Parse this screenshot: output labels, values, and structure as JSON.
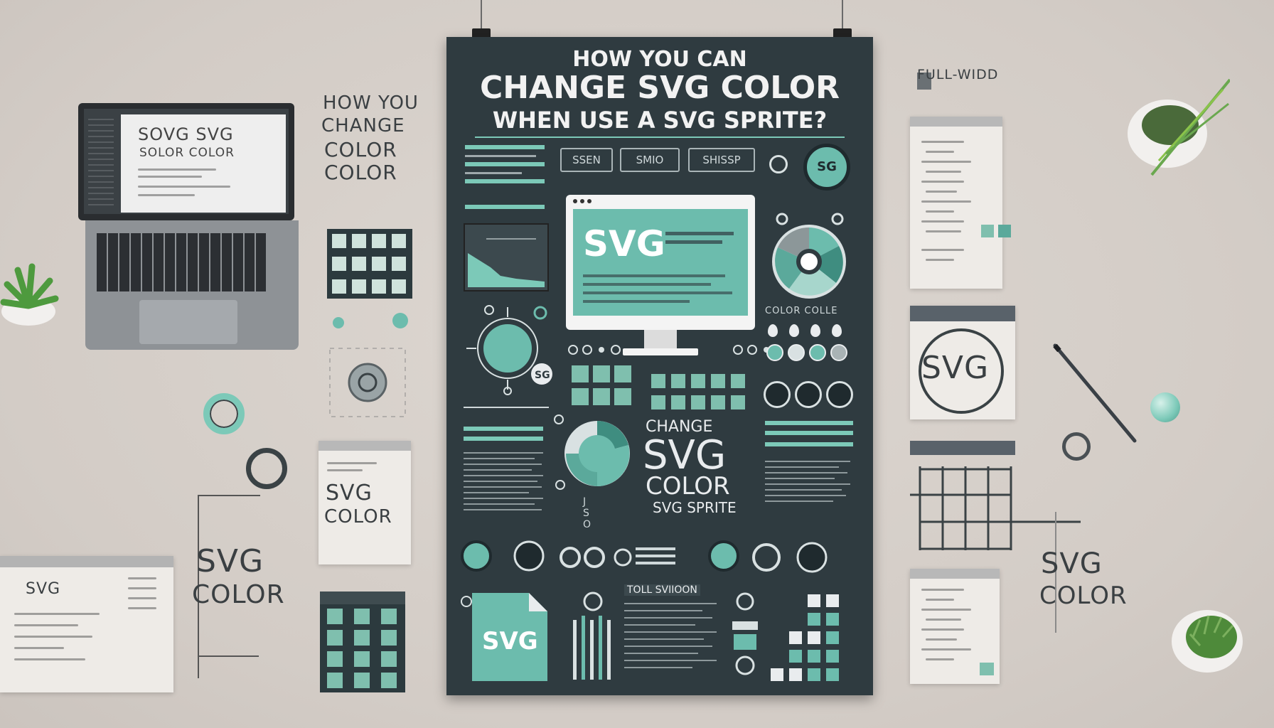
{
  "poster": {
    "title_line1": "HOW YOU CAN",
    "title_line2": "CHANGE SVG COLOR",
    "title_line3": "WHEN USE A SVG SPRITE?",
    "buttons": [
      "SSEN",
      "SMIO",
      "SHISSP"
    ],
    "monitor_text": "SVG",
    "color_circle_caption": "COLOR COLLE",
    "center_line1": "CHANGE",
    "center_line2": "SVG",
    "center_line3": "COLOR",
    "center_line4": "SVG SPRITE",
    "file_label": "SVG",
    "list_header": "TOLL SVIIOON",
    "left_small_text": "J S O"
  },
  "left": {
    "laptop_title_line1": "SOVG SVG",
    "laptop_title_line2": "SOLOR COLOR",
    "side_text_line1": "HOW YOU",
    "side_text_line2": "CHANGE",
    "side_text_line3": "COLOR",
    "side_text_line4": "COLOR",
    "card_line1": "SVG",
    "card_line2": "COLOR",
    "window_text": "SVG",
    "big_line1": "SVG",
    "big_line2": "COLOR"
  },
  "right": {
    "header_label": "FULL-WIDD",
    "circle_label": "SVG",
    "big_line1": "SVG",
    "big_line2": "COLOR"
  },
  "colors": {
    "background": "#d8d1cb",
    "poster": "#2f3b40",
    "teal": "#6cbcad",
    "text_dark": "#3a3f42"
  }
}
